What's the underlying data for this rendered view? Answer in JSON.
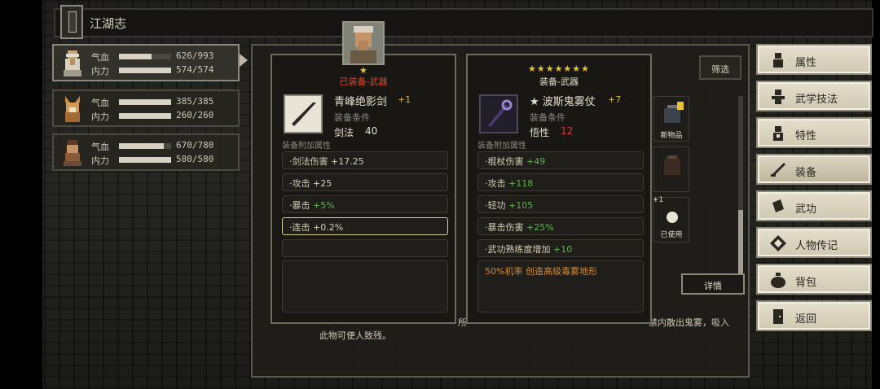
{
  "topbar": {
    "title": "江湖志"
  },
  "characters": [
    {
      "hp_label": "气血",
      "hp_value": "626/993",
      "hp_fraction": 0.63,
      "mp_label": "内力",
      "mp_value": "574/574",
      "mp_fraction": 1.0
    },
    {
      "hp_label": "气血",
      "hp_value": "385/385",
      "hp_fraction": 1.0,
      "mp_label": "内力",
      "mp_value": "260/260",
      "mp_fraction": 1.0
    },
    {
      "hp_label": "气血",
      "hp_value": "670/780",
      "hp_fraction": 0.86,
      "mp_label": "内力",
      "mp_value": "580/580",
      "mp_fraction": 1.0
    }
  ],
  "inventory": {
    "filter_label": "筛选",
    "new_item_label": "新物品",
    "used_label": "已使用",
    "badge_plus": "+1",
    "detail_label": "详情",
    "desc_line": "此物可使人致残。",
    "desc_right": "禁内散出鬼雾，吸入",
    "desc_mid": "所"
  },
  "compare_left": {
    "stars": "★",
    "status": "已装备-武器",
    "name": "青峰绝影剑",
    "plus": "+1",
    "req_label": "装备条件",
    "req_name": "剑法",
    "req_value": "40",
    "attr_header": "装备附加属性",
    "attrs": [
      {
        "name": "·剑法伤害",
        "value": "+17.25"
      },
      {
        "name": "·攻击",
        "value": "+25"
      },
      {
        "name": "·暴击",
        "value": "+5%"
      },
      {
        "name": "·连击",
        "value": "+0.2%"
      }
    ]
  },
  "compare_right": {
    "stars": "★★★★★★★",
    "status": "装备-武器",
    "name": "★ 波斯鬼雾仗",
    "plus": "+7",
    "req_label": "装备条件",
    "req_name": "悟性",
    "req_value": "12",
    "attr_header": "装备附加属性",
    "attrs": [
      {
        "name": "·棍杖伤害",
        "value": "+49"
      },
      {
        "name": "·攻击",
        "value": "+118"
      },
      {
        "name": "·轻功",
        "value": "+105"
      },
      {
        "name": "·暴击伤害",
        "value": "+25%"
      },
      {
        "name": "·武功熟练度增加",
        "value": "+10"
      }
    ],
    "special": "50%机率 创造高级毒雾地形"
  },
  "menu": [
    {
      "label": "属性",
      "icon": "person-icon"
    },
    {
      "label": "武学技法",
      "icon": "martial-arts-icon"
    },
    {
      "label": "特性",
      "icon": "traits-icon"
    },
    {
      "label": "装备",
      "icon": "sword-icon"
    },
    {
      "label": "武功",
      "icon": "book-icon"
    },
    {
      "label": "人物传记",
      "icon": "biography-icon"
    },
    {
      "label": "背包",
      "icon": "bag-icon"
    },
    {
      "label": "返回",
      "icon": "door-icon"
    }
  ],
  "colors": {
    "star": "#e9c430",
    "equipped_status": "#d9492f",
    "green_value": "#5fb54d",
    "red_requirement": "#d9383a",
    "special_text": "#d58a3a"
  }
}
